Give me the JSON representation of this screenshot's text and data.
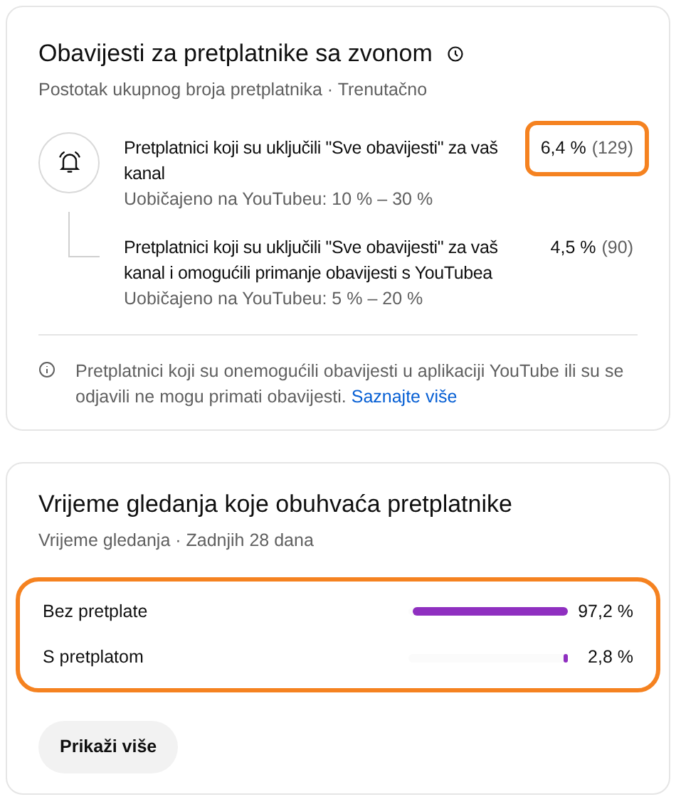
{
  "notifications_card": {
    "title": "Obavijesti za pretplatnike sa zvonom",
    "subtitle": "Postotak ukupnog broja pretplatnika · Trenutačno",
    "rows": [
      {
        "kind": "main",
        "label": "Pretplatnici koji su uključili \"Sve obavijesti\" za vaš kanal",
        "typical": "Uobičajeno na YouTubeu: 10 % – 30 %",
        "percent": "6,4 %",
        "count": "(129)",
        "highlighted": true
      },
      {
        "kind": "sub",
        "label": "Pretplatnici koji su uključili \"Sve obavijesti\" za vaš kanal i omogućili primanje obavijesti s YouTubea",
        "typical": "Uobičajeno na YouTubeu: 5 % – 20 %",
        "percent": "4,5 %",
        "count": "(90)",
        "highlighted": false
      }
    ],
    "info_text": "Pretplatnici koji su onemogućili obavijesti u aplikaciji YouTube ili su se odjavili ne mogu primati obavijesti.",
    "info_link": "Saznajte više"
  },
  "watch_time_card": {
    "title": "Vrijeme gledanja koje obuhvaća pretplatnike",
    "subtitle": "Vrijeme gledanja · Zadnjih 28 dana",
    "highlighted": true,
    "rows": [
      {
        "label": "Bez pretplate",
        "level": 0.972,
        "value": "97,2 %"
      },
      {
        "label": "S pretplatom",
        "level": 0.028,
        "value": "2,8 %"
      }
    ],
    "button": "Prikaži više"
  }
}
